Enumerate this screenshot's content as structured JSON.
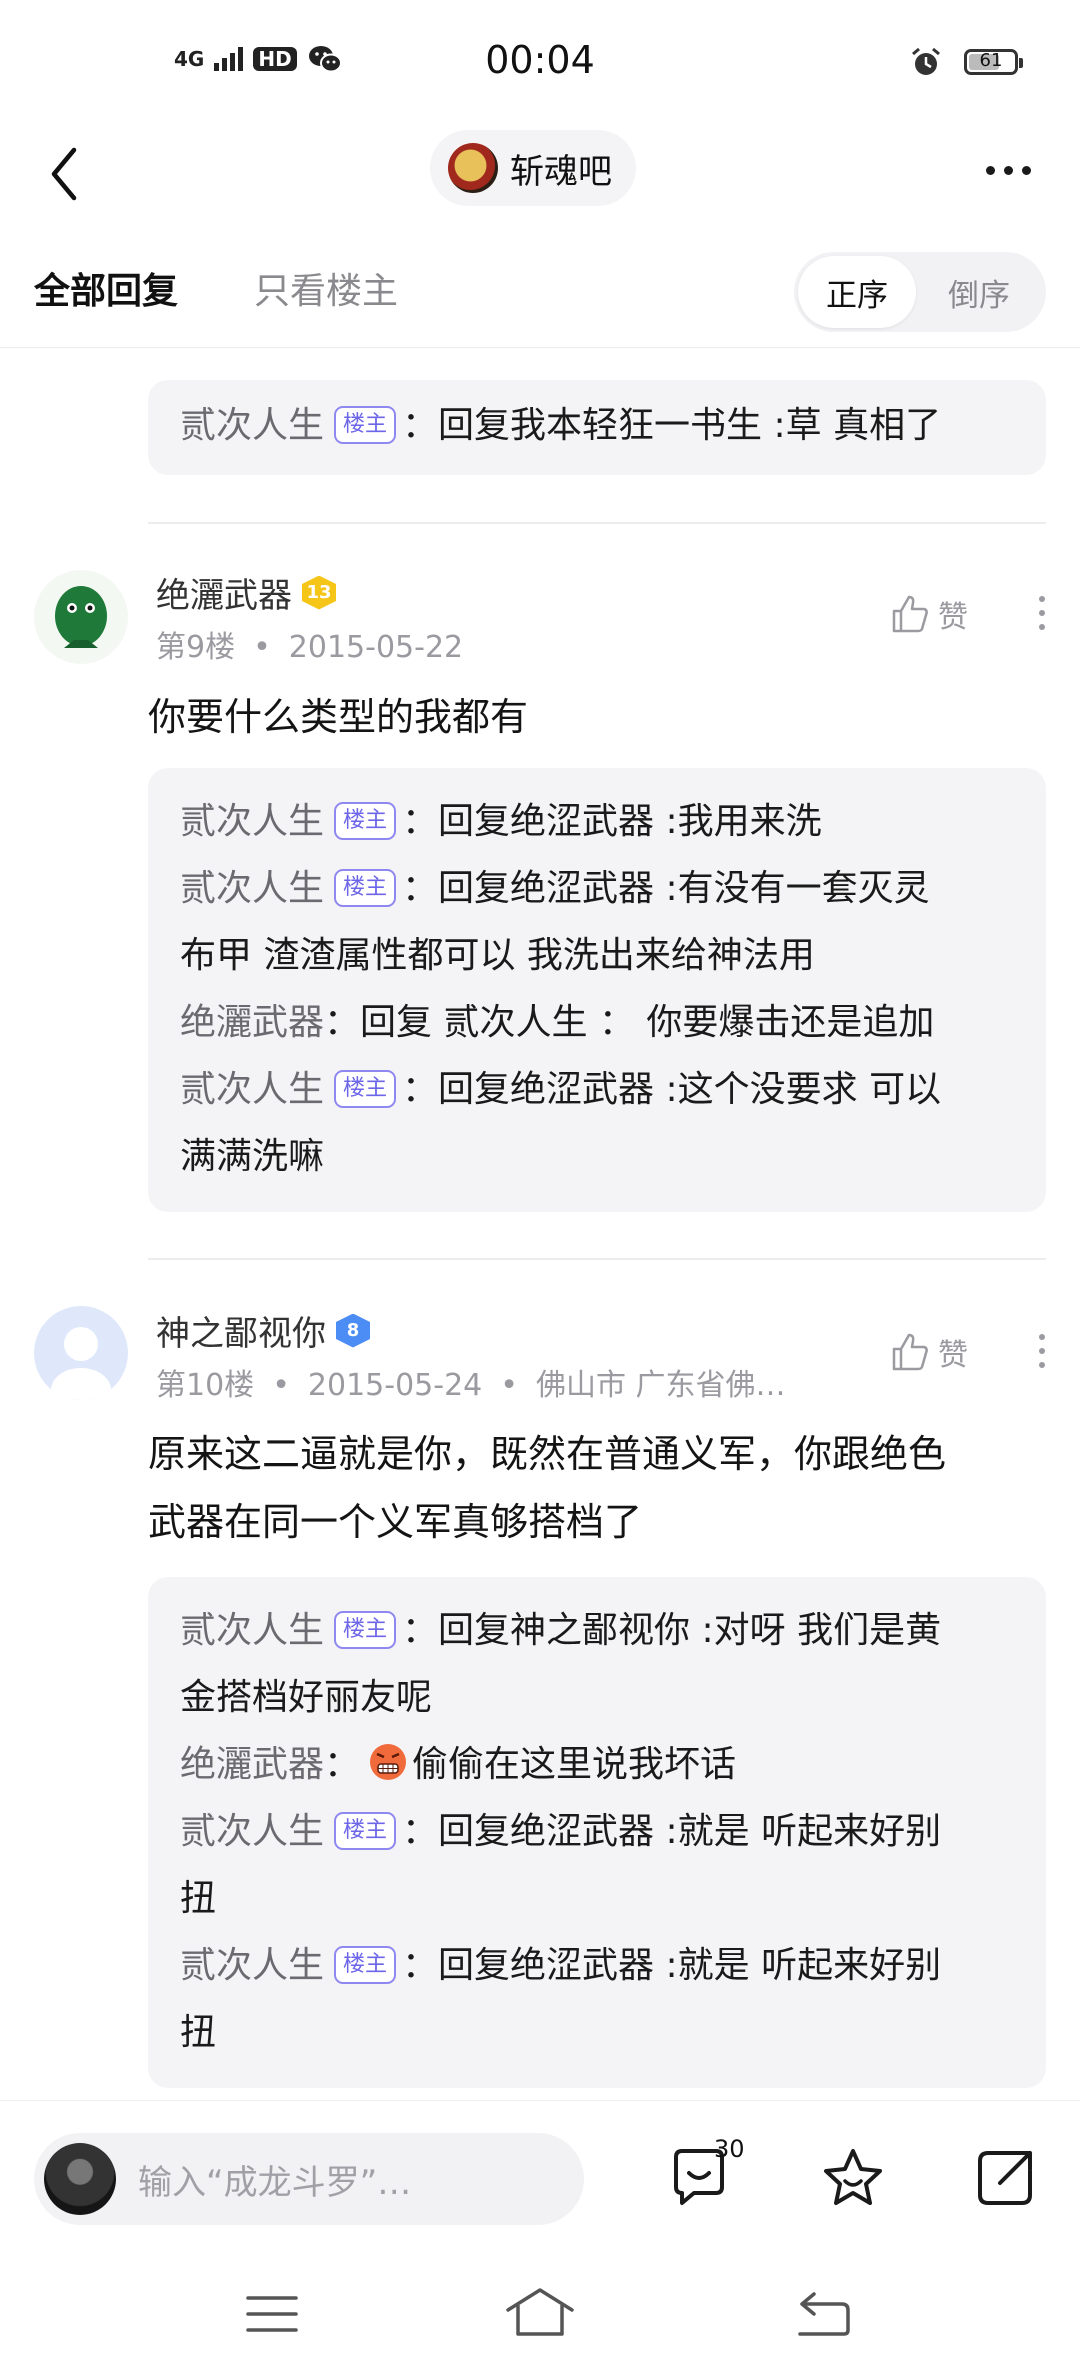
{
  "status_bar": {
    "signal": "4G",
    "hd": "HD",
    "time": "00:04",
    "battery": "61"
  },
  "nav": {
    "forum_name": "斩魂吧"
  },
  "filter": {
    "all_replies": "全部回复",
    "op_only": "只看楼主",
    "order_asc": "正序",
    "order_desc": "倒序"
  },
  "top_sub": {
    "user": "贰次人生",
    "op_label": "楼主",
    "sep": "：",
    "text": "回复我本轻狂一书生 :草 真相了"
  },
  "posts": [
    {
      "username": "绝灑武器",
      "level": "13",
      "floor": "第9楼",
      "date": "2015-05-22",
      "location": "",
      "like_label": "赞",
      "content": "你要什么类型的我都有",
      "subs": [
        {
          "user": "贰次人生",
          "op_label": "楼主",
          "sep": "：",
          "lines": [
            "回复绝涩武器 :我用来洗"
          ]
        },
        {
          "user": "贰次人生",
          "op_label": "楼主",
          "sep": "：",
          "lines": [
            "回复绝涩武器 :有没有一套灭灵",
            "布甲 渣渣属性都可以 我洗出来给神法用"
          ]
        },
        {
          "user": "绝灑武器",
          "op_label": "",
          "sep": "：",
          "lines": [
            "回复 贰次人生 ： 你要爆击还是追加"
          ]
        },
        {
          "user": "贰次人生",
          "op_label": "楼主",
          "sep": "：",
          "lines": [
            "回复绝涩武器 :这个没要求 可以",
            "满满洗嘛"
          ]
        }
      ]
    },
    {
      "username": "神之鄙视你",
      "level": "8",
      "floor": "第10楼",
      "date": "2015-05-24",
      "location": "佛山市 广东省佛…",
      "like_label": "赞",
      "content_lines": [
        "原来这二逼就是你，既然在普通义军，你跟绝色",
        "武器在同一个义军真够搭档了"
      ],
      "subs": [
        {
          "user": "贰次人生",
          "op_label": "楼主",
          "sep": "：",
          "lines": [
            "回复神之鄙视你 :对呀 我们是黄",
            "金搭档好丽友呢"
          ]
        },
        {
          "user": "绝灑武器",
          "op_label": "",
          "sep": "：",
          "lines": [
            "偷偷在这里说我坏话"
          ]
        },
        {
          "user": "贰次人生",
          "op_label": "楼主",
          "sep": "：",
          "lines": [
            "回复绝涩武器 :就是 听起来好别",
            "扭"
          ]
        },
        {
          "user": "贰次人生",
          "op_label": "楼主",
          "sep": "：",
          "lines": [
            "回复绝涩武器 :就是 听起来好别",
            "扭"
          ]
        }
      ]
    }
  ],
  "bottom_bar": {
    "input_placeholder": "输入“成龙斗罗”…",
    "comment_count": "30"
  },
  "icons": {
    "back": "back-arrow-icon",
    "more": "more-icon",
    "like": "thumbs-up-icon",
    "comment": "comment-icon",
    "favorite": "star-icon",
    "share": "share-icon",
    "emoji": "angry-emoji-icon"
  }
}
